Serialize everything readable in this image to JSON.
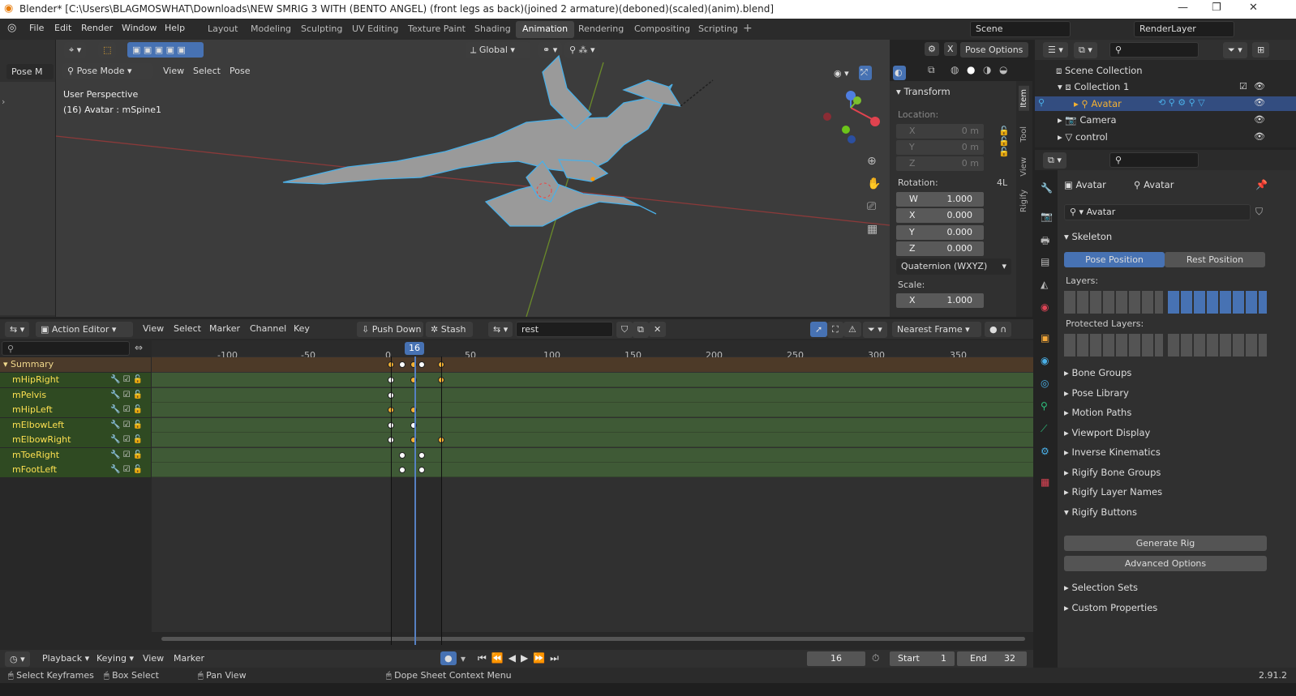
{
  "window": {
    "title": "Blender* [C:\\Users\\BLAGMOSWHAT\\Downloads\\NEW SMRIG 3 WITH (BENTO ANGEL) (front legs as back)(joined  2 armature)(deboned)(scaled)(anim).blend]",
    "min": "—",
    "max": "❐",
    "close": "✕"
  },
  "menus": [
    "File",
    "Edit",
    "Render",
    "Window",
    "Help"
  ],
  "workspaces": [
    "Layout",
    "Modeling",
    "Sculpting",
    "UV Editing",
    "Texture Paint",
    "Shading",
    "Animation",
    "Rendering",
    "Compositing",
    "Scripting"
  ],
  "active_workspace": "Animation",
  "scene": "Scene",
  "render_layer": "RenderLayer",
  "viewport": {
    "mode": "Pose Mode",
    "menus": [
      "View",
      "Select",
      "Pose"
    ],
    "orientation": "Global",
    "pose_options": "Pose Options",
    "perspective": "User Perspective",
    "active": "(16) Avatar : mSpine1",
    "left_mode": "Pose M"
  },
  "npanel": {
    "tabs": [
      "Item",
      "Tool",
      "View",
      "Rigify"
    ],
    "transform": "Transform",
    "location": "Location:",
    "loc": [
      {
        "axis": "X",
        "value": "0 m"
      },
      {
        "axis": "Y",
        "value": "0 m"
      },
      {
        "axis": "Z",
        "value": "0 m"
      }
    ],
    "rotation": "Rotation:",
    "rot_mode_short": "4L",
    "rot": [
      {
        "axis": "W",
        "value": "1.000"
      },
      {
        "axis": "X",
        "value": "0.000"
      },
      {
        "axis": "Y",
        "value": "0.000"
      },
      {
        "axis": "Z",
        "value": "0.000"
      }
    ],
    "rot_mode": "Quaternion (WXYZ)",
    "scale": "Scale:",
    "scl": [
      {
        "axis": "X",
        "value": "1.000"
      }
    ]
  },
  "dopesheet": {
    "editor": "Action Editor",
    "menus": [
      "View",
      "Select",
      "Marker",
      "Channel",
      "Key"
    ],
    "push_down": "Push Down",
    "stash": "Stash",
    "action": "rest",
    "snap": "Nearest Frame",
    "ticks": [
      "-100",
      "-50",
      "0",
      "16",
      "50",
      "100",
      "150",
      "200",
      "250",
      "300",
      "350"
    ],
    "channels": [
      "Summary",
      "mHipRight",
      "mPelvis",
      "mHipLeft",
      "mElbowLeft",
      "mElbowRight",
      "mToeRight",
      "mFootLeft"
    ]
  },
  "timeline": {
    "menus": [
      "Playback",
      "Keying",
      "View",
      "Marker"
    ],
    "frame": "16",
    "start_label": "Start",
    "start": "1",
    "end_label": "End",
    "end": "32"
  },
  "status": {
    "items": [
      "Select Keyframes",
      "Box Select",
      "Pan View",
      "Dope Sheet Context Menu"
    ],
    "version": "2.91.2"
  },
  "outliner": {
    "items": [
      "Scene Collection",
      "Collection 1",
      "Avatar",
      "Camera",
      "control"
    ]
  },
  "properties": {
    "crumb1": "Avatar",
    "crumb2": "Avatar",
    "data_name": "Avatar",
    "skeleton": "Skeleton",
    "pose_position": "Pose Position",
    "rest_position": "Rest Position",
    "layers": "Layers:",
    "protected": "Protected Layers:",
    "sections": [
      "Bone Groups",
      "Pose Library",
      "Motion Paths",
      "Viewport Display",
      "Inverse Kinematics",
      "Rigify Bone Groups",
      "Rigify Layer Names",
      "Rigify Buttons"
    ],
    "generate": "Generate Rig",
    "advanced": "Advanced Options",
    "sections2": [
      "Selection Sets",
      "Custom Properties"
    ]
  },
  "colors": {
    "accent": "#4772b3",
    "keyframe_selected": "#f4b132",
    "channel_green": "#3f5a36",
    "playhead": "#5680c2"
  }
}
